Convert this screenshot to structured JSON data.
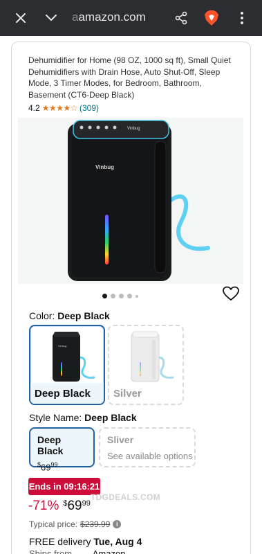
{
  "browser": {
    "url_prefix": "a",
    "url_domain": "amazon.com"
  },
  "product": {
    "title": "Dehumidifier for Home (98 OZ, 1000 sq ft), Small Quiet Dehumidifiers with Drain Hose, Auto Shut-Off, Sleep Mode, 3 Timer Modes, for Bedroom, Bathroom, Basement (CT6-Deep Black)",
    "rating_value": "4.2",
    "rating_stars": 4.2,
    "rating_count": "(309)",
    "brand_on_device": "Vinbug",
    "gallery": {
      "image_count": 5,
      "active_index": 0
    }
  },
  "color": {
    "label": "Color:",
    "selected": "Deep Black",
    "options": [
      {
        "name": "Deep Black",
        "selected": true
      },
      {
        "name": "Silver",
        "selected": false
      }
    ]
  },
  "style": {
    "label": "Style Name:",
    "selected": "Deep Black",
    "options": [
      {
        "name": "Deep Black",
        "price_symbol": "$",
        "price_whole": "69",
        "price_fraction": "99",
        "selected": true
      },
      {
        "name": "Sliver",
        "availability": "See available options",
        "selected": false
      }
    ]
  },
  "deal": {
    "badge": "Ends in 09:16:21",
    "discount": "-71%",
    "price_symbol": "$",
    "price_whole": "69",
    "price_fraction": "99",
    "watermark": "TDGDEALS.COM",
    "typical_label": "Typical price:",
    "typical_price": "$239.99"
  },
  "delivery": {
    "text_prefix": "FREE delivery",
    "date": "Tue, Aug 4",
    "ships_from_label": "Ships from",
    "ships_from_value": "Amazon"
  },
  "colors": {
    "topbar_bg": "#2b2d31",
    "selected_border": "#2162a1",
    "deal_red": "#cc0c39",
    "star_orange": "#de7921",
    "link_teal": "#007185"
  }
}
